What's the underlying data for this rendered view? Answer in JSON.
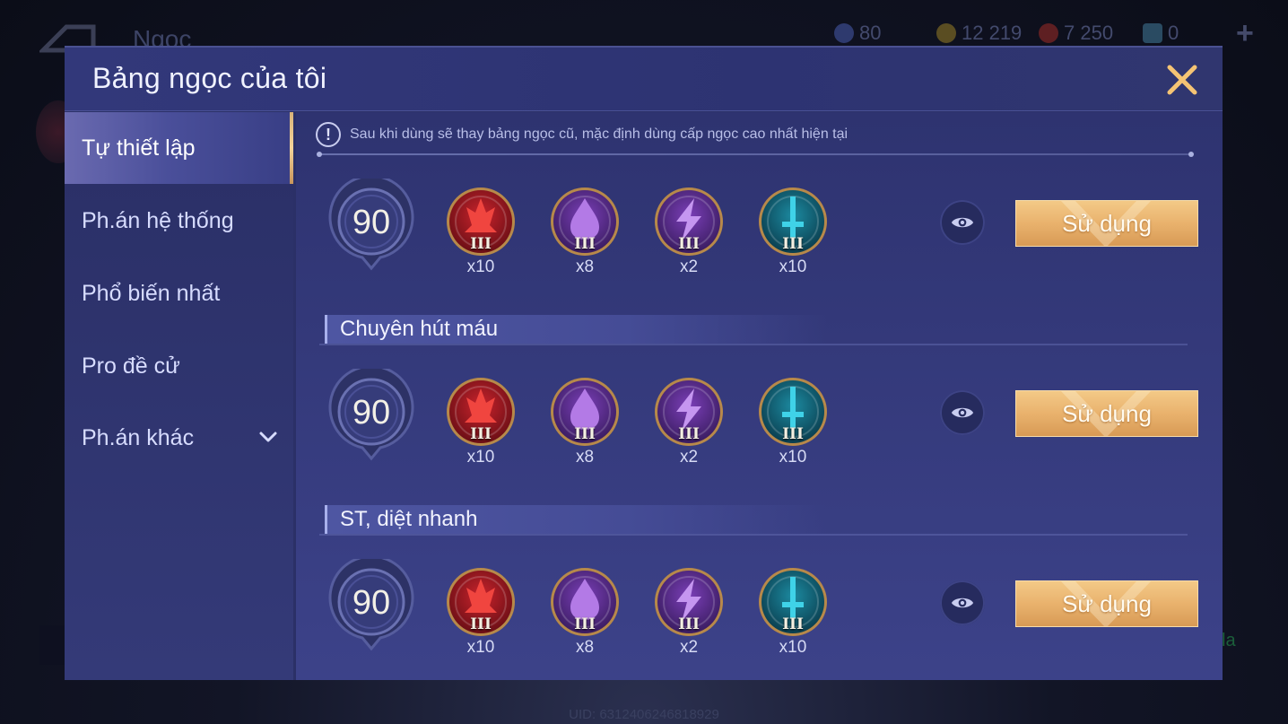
{
  "background": {
    "screen_title": "Ngọc",
    "resources": [
      {
        "icon": "marble-coin-icon",
        "value": "80",
        "color": "#4a5aa8"
      },
      {
        "icon": "gold-coin-icon",
        "value": "12 219",
        "color": "#b59a3a"
      },
      {
        "icon": "ruby-icon",
        "value": "7 250",
        "color": "#b8302c"
      },
      {
        "icon": "arcana-ticket-icon",
        "value": "0",
        "color": "#4a9cc8"
      }
    ],
    "add_icon": "plus-icon",
    "uid": "UID: 6312406246818929",
    "right_fragment": "la"
  },
  "modal": {
    "title": "Bảng ngọc của tôi",
    "close_icon": "close-icon"
  },
  "sidebar": {
    "items": [
      {
        "label": "Tự thiết lập",
        "active": true
      },
      {
        "label": "Ph.án hệ thống",
        "active": false
      },
      {
        "label": "Phổ biến nhất",
        "active": false
      },
      {
        "label": "Pro đề cử",
        "active": false
      },
      {
        "label": "Ph.án khác",
        "active": false,
        "expand_icon": "chevron-down-icon"
      }
    ]
  },
  "notice": {
    "icon": "exclamation-icon",
    "text": "Sau khi dùng sẽ thay bảng ngọc cũ, mặc định dùng cấp ngọc cao nhất hiện tại"
  },
  "sets": [
    {
      "name": "",
      "level": "90",
      "gems": [
        {
          "type": "red",
          "tier": "III",
          "count": "x10"
        },
        {
          "type": "purple-drop",
          "tier": "III",
          "count": "x8"
        },
        {
          "type": "purple-bolt",
          "tier": "III",
          "count": "x2"
        },
        {
          "type": "teal-sword",
          "tier": "III",
          "count": "x10"
        }
      ],
      "preview_icon": "eye-icon",
      "use_label": "Sử dụng"
    },
    {
      "name": "Chuyên hút máu",
      "level": "90",
      "gems": [
        {
          "type": "red",
          "tier": "III",
          "count": "x10"
        },
        {
          "type": "purple-drop",
          "tier": "III",
          "count": "x8"
        },
        {
          "type": "purple-bolt",
          "tier": "III",
          "count": "x2"
        },
        {
          "type": "teal-sword",
          "tier": "III",
          "count": "x10"
        }
      ],
      "preview_icon": "eye-icon",
      "use_label": "Sử dụng"
    },
    {
      "name": "ST, diệt nhanh",
      "level": "90",
      "gems": [
        {
          "type": "red",
          "tier": "III",
          "count": "x10"
        },
        {
          "type": "purple-drop",
          "tier": "III",
          "count": "x8"
        },
        {
          "type": "purple-bolt",
          "tier": "III",
          "count": "x2"
        },
        {
          "type": "teal-sword",
          "tier": "III",
          "count": "x10"
        }
      ],
      "preview_icon": "eye-icon",
      "use_label": "Sử dụng"
    }
  ],
  "colors": {
    "modal_bg": "#2b3067",
    "button_gold": "#e9b26d",
    "close_gold": "#f5c474",
    "gem_red": "#c8232c",
    "gem_purple": "#7b3fb8",
    "gem_teal": "#1c8aa0"
  }
}
